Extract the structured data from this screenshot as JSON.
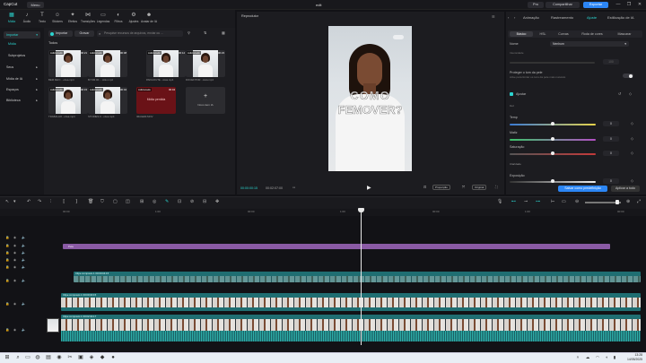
{
  "titlebar": {
    "logo": "CapCut",
    "menu": "Menu",
    "project": "edit",
    "pro": "Pro",
    "share": "Compartilhar",
    "export": "Exportar",
    "minimize": "—",
    "maximize": "❐",
    "close": "✕"
  },
  "toolbar": {
    "items": [
      {
        "label": "Mídia",
        "icon": "media-icon",
        "glyph": "▦"
      },
      {
        "label": "Áudio",
        "icon": "audio-icon",
        "glyph": "♪"
      },
      {
        "label": "Texto",
        "icon": "text-icon",
        "glyph": "T"
      },
      {
        "label": "Stickers",
        "icon": "sticker-icon",
        "glyph": "☺"
      },
      {
        "label": "Efeitos",
        "icon": "effects-icon",
        "glyph": "✦"
      },
      {
        "label": "Transições",
        "icon": "transition-icon",
        "glyph": "⋈"
      },
      {
        "label": "Legendas",
        "icon": "captions-icon",
        "glyph": "▭"
      },
      {
        "label": "Filtros",
        "icon": "filter-icon",
        "glyph": "◐"
      },
      {
        "label": "Ajustes",
        "icon": "adjust-icon",
        "glyph": "⚙"
      },
      {
        "label": "Avatar de IA",
        "icon": "avatar-icon",
        "glyph": "☻"
      }
    ]
  },
  "leftnav": {
    "importar": "Importar",
    "midia": "Mídia",
    "subprojetos": "Subprojetos",
    "seus": "Seus",
    "midia_ia": "Mídia de IA",
    "espacos": "Espaços",
    "biblioteca": "Biblioteca"
  },
  "media": {
    "import_label": "Importar",
    "record_label": "Gravar",
    "search_placeholder": "Pesquise recursos de arquivos, enviar ou ...",
    "todos": "Todos",
    "thumbs": [
      {
        "tag": "Adicionado",
        "dur": "00:21",
        "caption": "BEM FEIO ...otwa.mp4"
      },
      {
        "tag": "Adicionado",
        "dur": "00:08",
        "caption": "BYOM.00.....stiko.mp4"
      },
      {
        "tag": "Adicionado",
        "dur": "00:12",
        "caption": "PAKIAOUTE...otwa.mp4"
      },
      {
        "tag": "Adicionado",
        "dur": "00:23",
        "caption": "DOCEFITOR...otwa.mp4"
      },
      {
        "tag": "Adicionado",
        "dur": "00:15",
        "caption": "TRABALHO...otwa.mp4"
      },
      {
        "tag": "Adicionado",
        "dur": "00:04",
        "caption": "STORIES.C...otwa.mp4"
      },
      {
        "tag": "Adicionado",
        "dur": "00:04",
        "caption": "IMAGEM.MOV"
      }
    ],
    "missing": "Mídia perdida",
    "add_new": "Novo item IA"
  },
  "player": {
    "title": "Reprodutor",
    "overlay_line1": "COMO",
    "overlay_line2": "FEMOVER?",
    "time_current": "00:00:00:15",
    "time_total": "00:02:07:00",
    "ratio": "Proporção",
    "full": "Original"
  },
  "rpanel": {
    "tabs": [
      "Animação",
      "Rastreamento",
      "Ajuste",
      "Estilização de IA"
    ],
    "subtabs": [
      "Básico",
      "HSL",
      "Curvas",
      "Roda de cores",
      "Mascarar"
    ],
    "nome_label": "Nome",
    "nome_value": "Nenhum",
    "intensidade": "Intensidade",
    "intensidade_value": "100",
    "protect_label": "Proteger o tom da pele",
    "protect_sub": "Ative para limitar os tons da pele mais naturais",
    "ajustar": "Ajustar",
    "cor": "Cor",
    "temp": "Temp",
    "matiz": "Matiz",
    "saturacao": "Saturação",
    "claridade": "Claridade",
    "exposicao": "Exposição",
    "temp_value": "0",
    "matiz_value": "0",
    "saturacao_value": "0",
    "exposicao_value": "0",
    "save_preset": "Salvar como predefinição",
    "apply_all": "Aplicar a todo"
  },
  "timeline": {
    "ruler": [
      "00:00",
      "1:00",
      "00:00",
      "1:00",
      "00:00",
      "1:00",
      "00:00"
    ],
    "clip_purple": "Pele",
    "clip_b": "Clipe composto 1  00:00:04:15",
    "clip_c": "Clipe composto 1  00:00:04:15",
    "clip_d": "Clipe composto 1  00:02:04:17"
  },
  "taskbar": {
    "time": "13:28",
    "date": "14/05/2025"
  }
}
